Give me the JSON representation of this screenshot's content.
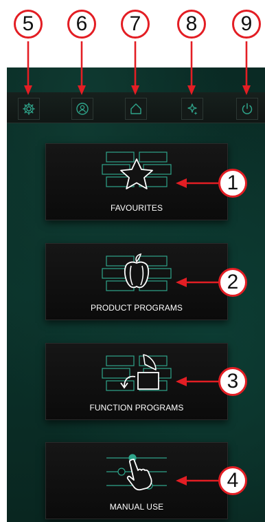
{
  "callouts": {
    "top": [
      "5",
      "6",
      "7",
      "8",
      "9"
    ],
    "side": [
      "1",
      "2",
      "3",
      "4"
    ]
  },
  "toolbar": {
    "settings_icon": "gear-icon",
    "user_icon": "user-icon",
    "home_icon": "home-icon",
    "cleaning_icon": "sparkle-icon",
    "power_icon": "power-icon"
  },
  "menu": {
    "favourites": "FAVOURITES",
    "product_programs": "PRODUCT PROGRAMS",
    "function_programs": "FUNCTION PROGRAMS",
    "manual_use": "MANUAL USE"
  },
  "colors": {
    "accent": "#2fa58b",
    "callout": "#e31e24",
    "background": "#0b332b"
  }
}
